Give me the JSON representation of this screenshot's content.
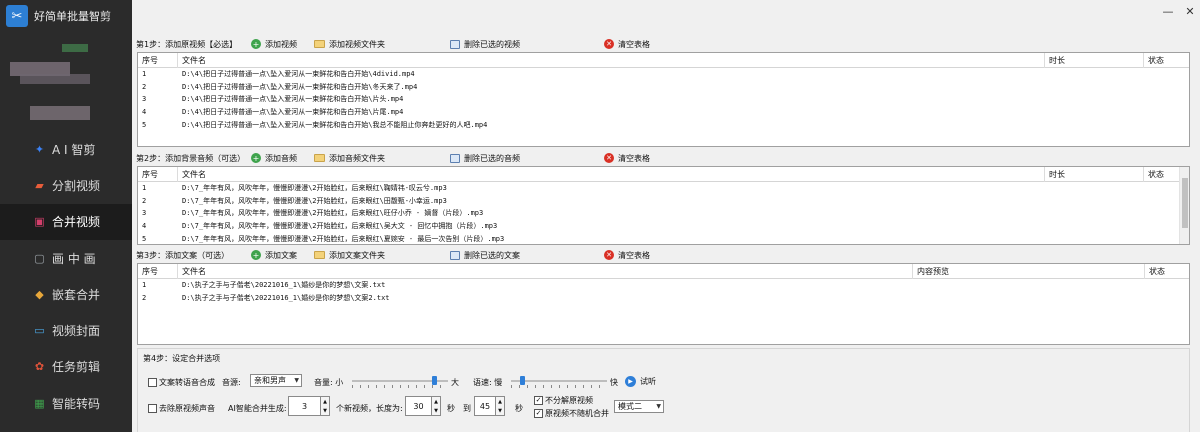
{
  "app": {
    "title": "好简单批量智剪",
    "logo_glyph": "✂"
  },
  "window_controls": {
    "minimize": "—",
    "maximize": "☐",
    "close": "✕"
  },
  "sidebar": {
    "items": [
      {
        "label": "A I 智剪",
        "icon": "ai-icon",
        "glyph": "✦",
        "color": "#3b82f6",
        "active": false
      },
      {
        "label": "分割视频",
        "icon": "split-icon",
        "glyph": "▰",
        "color": "#e85d3a",
        "active": false
      },
      {
        "label": "合并视频",
        "icon": "merge-icon",
        "glyph": "▣",
        "color": "#d33f6b",
        "active": true
      },
      {
        "label": "画 中 画",
        "icon": "pip-icon",
        "glyph": "▢",
        "color": "#9aa0a6",
        "active": false
      },
      {
        "label": "嵌套合并",
        "icon": "nest-icon",
        "glyph": "◆",
        "color": "#e8a73a",
        "active": false
      },
      {
        "label": "视频封面",
        "icon": "cover-icon",
        "glyph": "▭",
        "color": "#4aa3df",
        "active": false
      },
      {
        "label": "任务剪辑",
        "icon": "task-icon",
        "glyph": "✿",
        "color": "#e0533a",
        "active": false
      },
      {
        "label": "智能转码",
        "icon": "transcode-icon",
        "glyph": "▦",
        "color": "#3fa34d",
        "active": false
      }
    ]
  },
  "step1": {
    "title": "第1步：添加原视频【必选】",
    "buttons": [
      "添加视频",
      "添加视频文件夹",
      "删除已选的视频",
      "清空表格"
    ],
    "headers": [
      "序号",
      "文件名",
      "时长",
      "状态"
    ],
    "rows": [
      [
        "1",
        "D:\\4\\把日子过得普通一点\\坠入爱河从一束鲜花和告白开始\\4divid.mp4",
        "",
        ""
      ],
      [
        "2",
        "D:\\4\\把日子过得普通一点\\坠入爱河从一束鲜花和告白开始\\冬天来了.mp4",
        "",
        ""
      ],
      [
        "3",
        "D:\\4\\把日子过得普通一点\\坠入爱河从一束鲜花和告白开始\\片头.mp4",
        "",
        ""
      ],
      [
        "4",
        "D:\\4\\把日子过得普通一点\\坠入爱河从一束鲜花和告白开始\\片尾.mp4",
        "",
        ""
      ],
      [
        "5",
        "D:\\4\\把日子过得普通一点\\坠入爱河从一束鲜花和告白开始\\我总不能阻止你奔赴更好的人吧.mp4",
        "",
        ""
      ]
    ]
  },
  "step2": {
    "title": "第2步：添加背景音频（可选）",
    "buttons": [
      "添加音频",
      "添加音频文件夹",
      "删除已选的音频",
      "清空表格"
    ],
    "headers": [
      "序号",
      "文件名",
      "时长",
      "状态"
    ],
    "rows": [
      [
        "1",
        "D:\\7_年年有风，风吹年年，慢慢即漫漫\\2开始脸红，后来眼红\\鞠婧祎-叹云兮.mp3",
        "",
        ""
      ],
      [
        "2",
        "D:\\7_年年有风，风吹年年，慢慢即漫漫\\2开始脸红，后来眼红\\田馥甄-小幸运.mp3",
        "",
        ""
      ],
      [
        "3",
        "D:\\7_年年有风，风吹年年，慢慢即漫漫\\2开始脸红，后来眼红\\旺仔小乔 - 嫡督（片段）.mp3",
        "",
        ""
      ],
      [
        "4",
        "D:\\7_年年有风，风吹年年，慢慢即漫漫\\2开始脸红，后来眼红\\吴大文 - 回忆中拥抱（片段）.mp3",
        "",
        ""
      ],
      [
        "5",
        "D:\\7_年年有风，风吹年年，慢慢即漫漫\\2开始脸红，后来眼红\\夏婉安 - 最后一次告别（片段）.mp3",
        "",
        ""
      ]
    ]
  },
  "step3": {
    "title": "第3步：添加文案（可选）",
    "buttons": [
      "添加文案",
      "添加文案文件夹",
      "删除已选的文案",
      "清空表格"
    ],
    "headers": [
      "序号",
      "文件名",
      "内容预览",
      "状态"
    ],
    "rows": [
      [
        "1",
        "D:\\执子之手与子偕老\\20221016_1\\婚纱是你的梦想\\文案.txt",
        "",
        ""
      ],
      [
        "2",
        "D:\\执子之手与子偕老\\20221016_1\\婚纱是你的梦想\\文案2.txt",
        "",
        ""
      ]
    ]
  },
  "step4": {
    "title": "第4步：设定合并选项",
    "tts_label": "文案转语音合成",
    "tts_checked": false,
    "voice_label": "音源:",
    "voice_value": "亲和男声",
    "volume_label": "音量: 小",
    "volume_max": "大",
    "volume_level": 0.88,
    "speed_label": "语速: 慢",
    "speed_max": "快",
    "speed_level": 0.1,
    "audition_label": "试听",
    "remove_audio_label": "去除原视频声音",
    "remove_audio_checked": false,
    "ai_gen_label": "AI智能合并生成:",
    "count_value": "3",
    "count_suffix": "个新视频，长度为:",
    "len_min": "30",
    "sec_label": "秒",
    "to_label": "到",
    "len_max": "45",
    "sec_label2": "秒",
    "no_split_label": "不分解原视频",
    "no_split_checked": true,
    "no_random_label": "原视频不随机合并",
    "no_random_checked": true,
    "mode_value": "模式二"
  }
}
